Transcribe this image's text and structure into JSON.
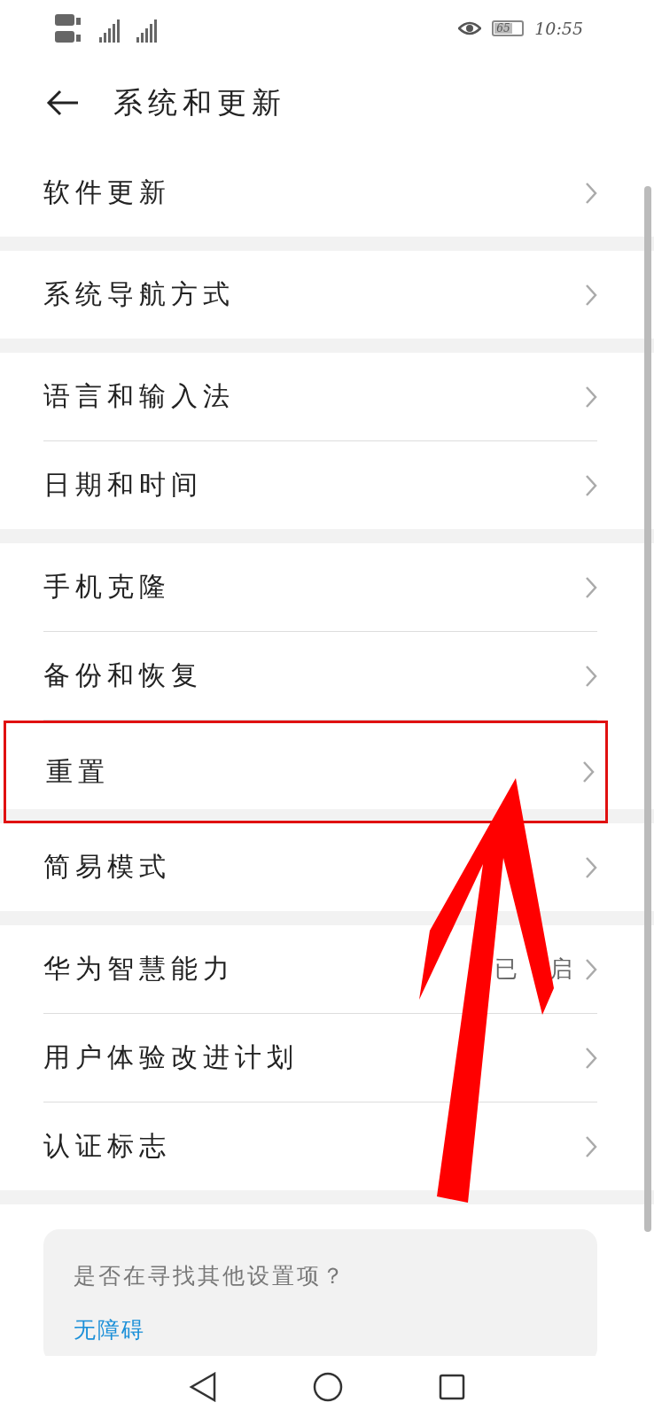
{
  "status_bar": {
    "time": "10:55",
    "battery": "65"
  },
  "header": {
    "title": "系统和更新"
  },
  "groups": [
    {
      "items": [
        {
          "label": "软件更新",
          "highlighted": false
        }
      ]
    },
    {
      "items": [
        {
          "label": "系统导航方式",
          "highlighted": false
        }
      ]
    },
    {
      "items": [
        {
          "label": "语言和输入法",
          "highlighted": false
        },
        {
          "label": "日期和时间",
          "highlighted": false
        }
      ]
    },
    {
      "items": [
        {
          "label": "手机克隆",
          "highlighted": false
        },
        {
          "label": "备份和恢复",
          "highlighted": false
        },
        {
          "label": "重置",
          "highlighted": true
        }
      ]
    },
    {
      "items": [
        {
          "label": "简易模式",
          "highlighted": false
        }
      ]
    },
    {
      "items": [
        {
          "label": "华为智慧能力",
          "highlighted": false,
          "value_parts": [
            "已",
            "启"
          ]
        },
        {
          "label": "用户体验改进计划",
          "highlighted": false
        },
        {
          "label": "认证标志",
          "highlighted": false
        }
      ]
    }
  ],
  "suggestion_card": {
    "question": "是否在寻找其他设置项？",
    "link": "无障碍"
  }
}
